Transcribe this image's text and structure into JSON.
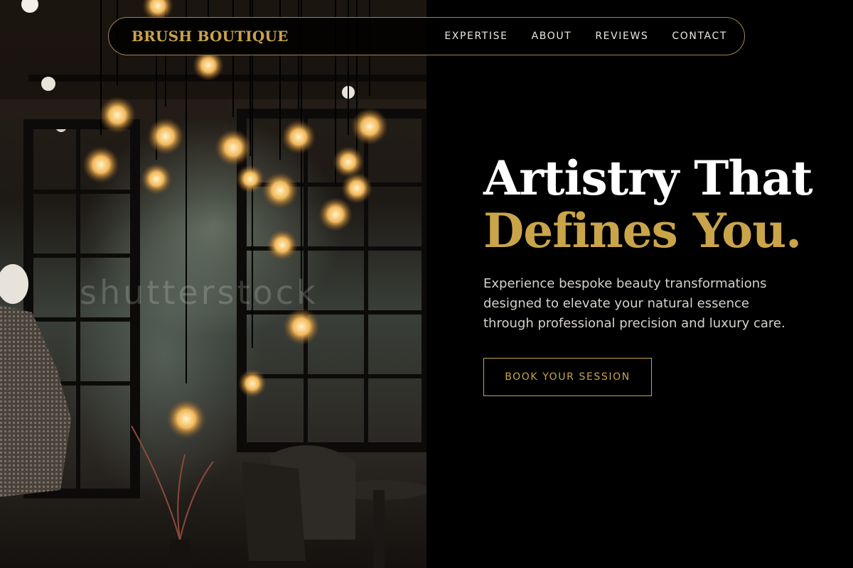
{
  "brand": {
    "name": "BRUSH BOUTIQUE"
  },
  "nav": {
    "items": [
      "EXPERTISE",
      "ABOUT",
      "REVIEWS",
      "CONTACT"
    ]
  },
  "hero": {
    "headline_line1": "Artistry That",
    "headline_line2": "Defines You.",
    "lead": "Experience bespoke beauty transformations designed to elevate your natural essence through professional precision and luxury care.",
    "cta_label": "BOOK YOUR SESSION"
  },
  "photo": {
    "watermark": "shutterstock"
  },
  "colors": {
    "accent_gold": "#c9a449",
    "background": "#000000",
    "text_light": "#d6d2cb"
  }
}
